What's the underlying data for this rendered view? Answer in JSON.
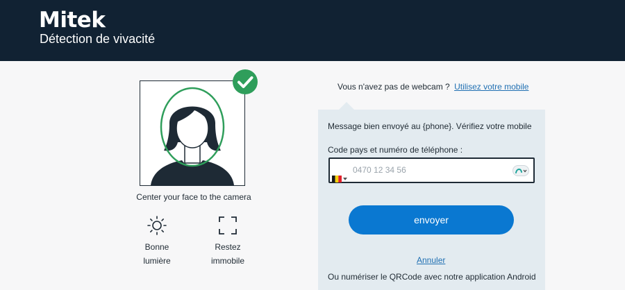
{
  "brand": {
    "logo": "Mitek",
    "subtitle": "Détection de vivacité"
  },
  "capture": {
    "caption": "Center your face to the camera",
    "tips": [
      {
        "icon": "sun-icon",
        "line1": "Bonne",
        "line2": "lumière"
      },
      {
        "icon": "frame-corners-icon",
        "line1": "Restez",
        "line2": "immobile"
      }
    ],
    "status_icon": "check-circle-icon",
    "accent": "#2f9e5b"
  },
  "webcam": {
    "question": "Vous n'avez pas de webcam ?",
    "link": "Utilisez votre mobile"
  },
  "panel": {
    "message": "Message bien envoyé au {phone}. Vérifiez votre mobile",
    "phone_label": "Code pays et numéro de téléphone :",
    "phone_value": "",
    "phone_placeholder": "0470 12 34 56",
    "country_flag": "belgium-flag-icon",
    "send_button": "envoyer",
    "cancel_link": "Annuler",
    "qr_text": "Ou numériser le QRCode avec notre application Android"
  },
  "colors": {
    "header": "#112233",
    "button": "#0a78d1",
    "link": "#1f6fb2",
    "panel": "#e3ebf0"
  }
}
